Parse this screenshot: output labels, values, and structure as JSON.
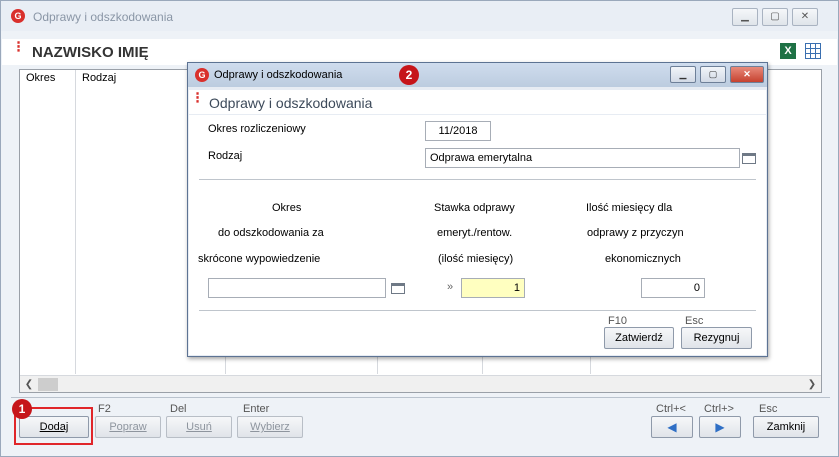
{
  "window": {
    "title": "Odprawy i odszkodowania",
    "app_icon": "G",
    "controls": [
      "minimize-icon",
      "restore-icon",
      "close-icon"
    ]
  },
  "header": {
    "title": "NAZWISKO IMIĘ",
    "icons": [
      "excel-export-icon",
      "grid-settings-icon"
    ]
  },
  "table": {
    "columns": [
      "Okres",
      "Rodzaj"
    ]
  },
  "toolbar": {
    "add": {
      "key": "",
      "label": "Dodaj"
    },
    "edit": {
      "key": "F2",
      "label": "Popraw"
    },
    "delete": {
      "key": "Del",
      "label": "Usuń"
    },
    "select": {
      "key": "Enter",
      "label": "Wybierz"
    },
    "prev": {
      "key": "Ctrl+<"
    },
    "next": {
      "key": "Ctrl+>"
    },
    "close": {
      "key": "Esc",
      "label": "Zamknij"
    }
  },
  "badges": {
    "one": "1",
    "two": "2"
  },
  "dialog": {
    "title": "Odprawy i odszkodowania",
    "heading": "Odprawy i odszkodowania",
    "okres_label": "Okres rozliczeniowy",
    "okres_value": "11/2018",
    "rodzaj_label": "Rodzaj",
    "rodzaj_value": "Odprawa emerytalna",
    "col1": [
      "Okres",
      "do odszkodowania za",
      "skrócone wypowiedzenie"
    ],
    "col2": [
      "Stawka odprawy",
      "emeryt./rentow.",
      "(ilość miesięcy)"
    ],
    "col3": [
      "Ilość miesięcy dla",
      "odprawy z przyczyn",
      "ekonomicznych"
    ],
    "okres_field_value": "",
    "arrow": "»",
    "stawka_value": "1",
    "ilosc_value": "0",
    "confirm": {
      "key": "F10",
      "label": "Zatwierdź"
    },
    "cancel": {
      "key": "Esc",
      "label": "Rezygnuj"
    }
  },
  "colors": {
    "accent": "#d9302c",
    "highlight": "#e0262a",
    "input_yellow": "#ffffc0"
  }
}
